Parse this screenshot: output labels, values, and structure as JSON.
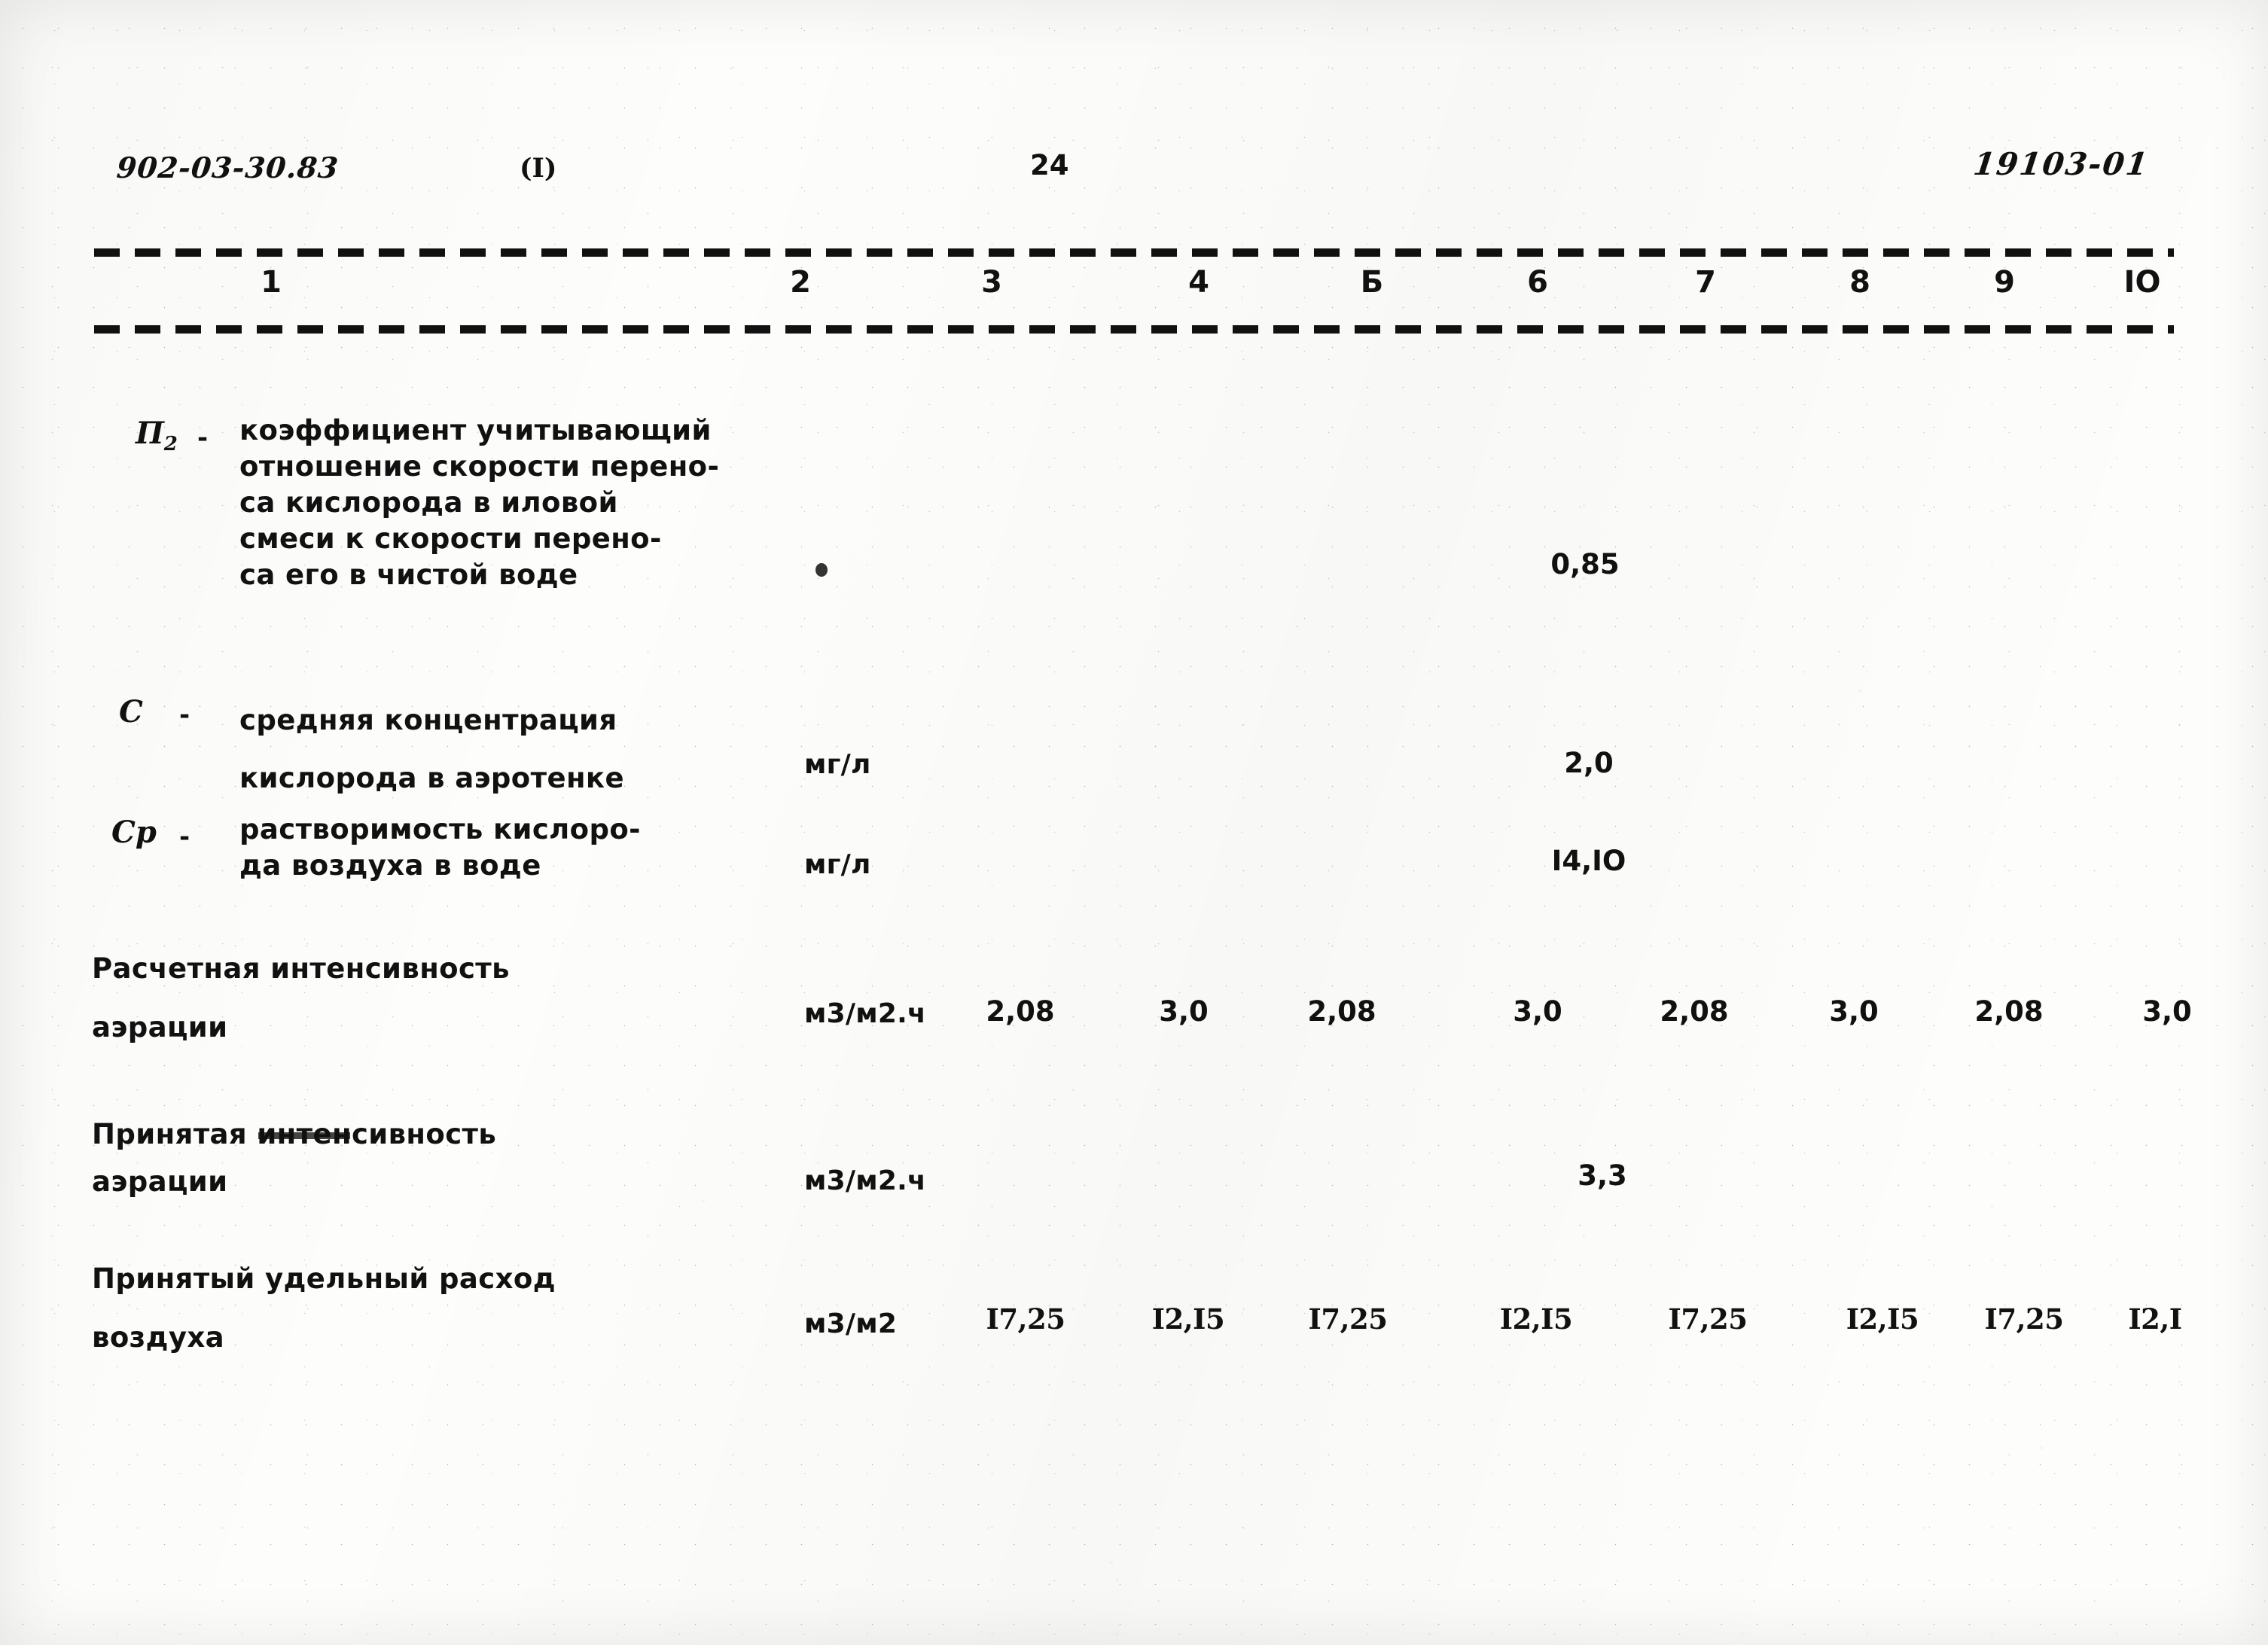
{
  "header": {
    "series_code": "902-03-30.83",
    "variant": "(I)",
    "page_number": "24",
    "doc_number": "19103-01"
  },
  "table": {
    "column_numbers": [
      "1",
      "2",
      "3",
      "4",
      "Б",
      "6",
      "7",
      "8",
      "9",
      "IO"
    ],
    "rows": [
      {
        "symbol": "П",
        "symbol_sub": "2",
        "dash": "-",
        "description": "коэффициент учитывающий\nотношение скорости перено-\nса кислорода в иловой\nсмеси к скорости перено-\nса его в чистой воде",
        "unit": "",
        "values": [
          "",
          "",
          "",
          "",
          "0,85",
          "",
          "",
          "",
          ""
        ]
      },
      {
        "symbol": "С",
        "symbol_sub": "",
        "dash": "-",
        "description": "средняя концентрация\nкислорода в аэротенке",
        "unit": "мг/л",
        "values": [
          "",
          "",
          "",
          "",
          "2,0",
          "",
          "",
          "",
          ""
        ]
      },
      {
        "symbol": "Ср",
        "symbol_sub": "",
        "dash": "-",
        "description": "растворимость кислоро-\nда воздуха в воде",
        "unit": "мг/л",
        "values": [
          "",
          "",
          "",
          "",
          "I4,IO",
          "",
          "",
          "",
          ""
        ]
      },
      {
        "symbol": "",
        "symbol_sub": "",
        "dash": "",
        "description": "Расчетная интенсивность\nаэрации",
        "unit": "м3/м2.ч",
        "values": [
          "2,08",
          "3,0",
          "2,08",
          "3,0",
          "2,08",
          "3,0",
          "2,08",
          "3,0"
        ]
      },
      {
        "symbol": "",
        "symbol_sub": "",
        "dash": "",
        "description_pre": "Принятая ",
        "description_struck": "интен",
        "description_post": "сивность",
        "description": "Принятая интенсивность\nаэрации",
        "unit": "м3/м2.ч",
        "values": [
          "",
          "",
          "",
          "",
          "3,3",
          "",
          "",
          "",
          ""
        ]
      },
      {
        "symbol": "",
        "symbol_sub": "",
        "dash": "",
        "description": "Принятый удельный расход\nвоздуха",
        "unit": "м3/м2",
        "values": [
          "I7,25",
          "I2,I5",
          "I7,25",
          "I2,I5",
          "I7,25",
          "I2,I5",
          "I7,25",
          "I2,I"
        ]
      }
    ]
  }
}
